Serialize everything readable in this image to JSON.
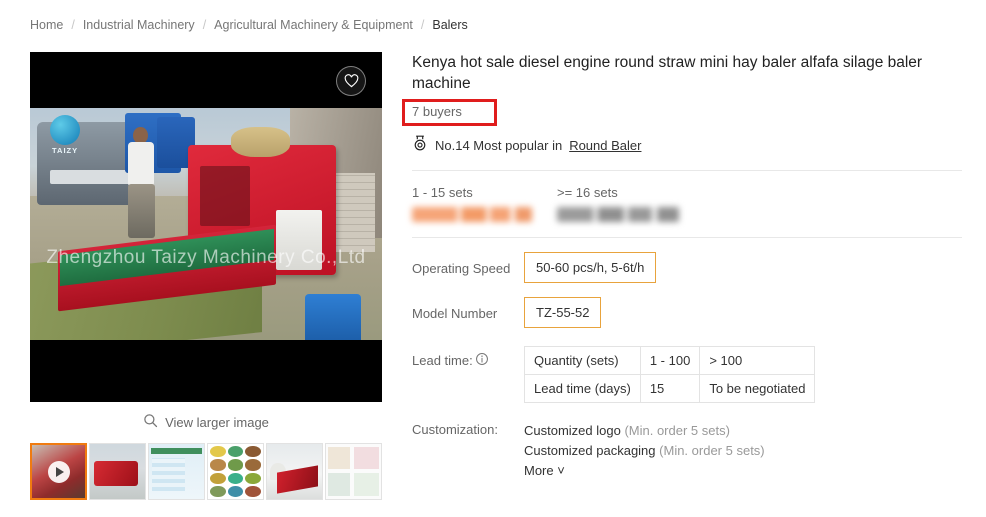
{
  "breadcrumb": {
    "items": [
      "Home",
      "Industrial Machinery",
      "Agricultural Machinery & Equipment",
      "Balers"
    ],
    "separator": "/"
  },
  "gallery": {
    "watermark": "Zhengzhou Taizy Machinery Co.,Ltd",
    "logo_text": "TAIZY",
    "wishlist_icon": "heart-icon",
    "view_larger_label": "View larger image",
    "search_icon": "magnifier-icon",
    "thumbnails": [
      {
        "name": "video-thumbnail",
        "selected": true,
        "has_play": true
      },
      {
        "name": "product-thumbnail-2",
        "selected": false,
        "has_play": false
      },
      {
        "name": "product-thumbnail-3",
        "selected": false,
        "has_play": false
      },
      {
        "name": "product-thumbnail-4",
        "selected": false,
        "has_play": false
      },
      {
        "name": "product-thumbnail-5",
        "selected": false,
        "has_play": false
      },
      {
        "name": "product-thumbnail-6",
        "selected": false,
        "has_play": false
      }
    ]
  },
  "product": {
    "title": "Kenya hot sale diesel engine round straw mini hay baler alfafa silage baler machine",
    "buyers": "7 buyers",
    "rank_icon": "medal-icon",
    "rank_prefix": "No.14 Most popular in",
    "rank_category": "Round Baler",
    "highlight_color": "#e01d1d"
  },
  "pricing": {
    "tiers": [
      {
        "range": "1 - 15 sets",
        "price": "",
        "redacted": true,
        "color": "#f5a678"
      },
      {
        "range": ">= 16 sets",
        "price": "",
        "redacted": true,
        "color": "#9b9b9b"
      }
    ]
  },
  "attributes": [
    {
      "label": "Operating Speed",
      "value": "50-60 pcs/h, 5-6t/h"
    },
    {
      "label": "Model Number",
      "value": "TZ-55-52"
    }
  ],
  "lead_time": {
    "label": "Lead time:",
    "info_icon": "info-icon",
    "rows": [
      [
        "Quantity (sets)",
        "1 - 100",
        "> 100"
      ],
      [
        "Lead time (days)",
        "15",
        "To be negotiated"
      ]
    ]
  },
  "customization": {
    "label": "Customization:",
    "options": [
      {
        "name": "Customized logo",
        "note": "(Min. order 5 sets)"
      },
      {
        "name": "Customized packaging",
        "note": "(Min. order 5 sets)"
      }
    ],
    "more_label": "More ˅"
  }
}
